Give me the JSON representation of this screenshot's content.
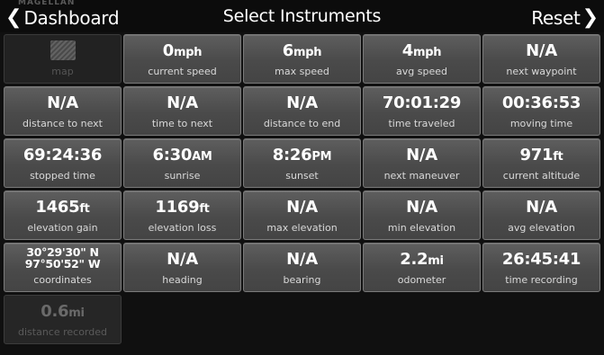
{
  "header": {
    "brand": "MAGELLAN",
    "back_label": "Dashboard",
    "title": "Select Instruments",
    "reset_label": "Reset"
  },
  "tiles": [
    {
      "value": "",
      "unit": "",
      "label": "map"
    },
    {
      "value": "0",
      "unit": "mph",
      "label": "current speed"
    },
    {
      "value": "6",
      "unit": "mph",
      "label": "max speed"
    },
    {
      "value": "4",
      "unit": "mph",
      "label": "avg speed"
    },
    {
      "value": "N/A",
      "unit": "",
      "label": "next waypoint"
    },
    {
      "value": "N/A",
      "unit": "",
      "label": "distance to next"
    },
    {
      "value": "N/A",
      "unit": "",
      "label": "time to next"
    },
    {
      "value": "N/A",
      "unit": "",
      "label": "distance to end"
    },
    {
      "value": "70:01:29",
      "unit": "",
      "label": "time traveled"
    },
    {
      "value": "00:36:53",
      "unit": "",
      "label": "moving time"
    },
    {
      "value": "69:24:36",
      "unit": "",
      "label": "stopped time"
    },
    {
      "value": "6:30",
      "unit": "AM",
      "label": "sunrise"
    },
    {
      "value": "8:26",
      "unit": "PM",
      "label": "sunset"
    },
    {
      "value": "N/A",
      "unit": "",
      "label": "next maneuver"
    },
    {
      "value": "971",
      "unit": "ft",
      "label": "current altitude"
    },
    {
      "value": "1465",
      "unit": "ft",
      "label": "elevation gain"
    },
    {
      "value": "1169",
      "unit": "ft",
      "label": "elevation loss"
    },
    {
      "value": "N/A",
      "unit": "",
      "label": "max elevation"
    },
    {
      "value": "N/A",
      "unit": "",
      "label": "min elevation"
    },
    {
      "value": "N/A",
      "unit": "",
      "label": "avg elevation"
    },
    {
      "value_line1": "30°29'30\" N",
      "value_line2": "97°50'52\" W",
      "label": "coordinates"
    },
    {
      "value": "N/A",
      "unit": "",
      "label": "heading"
    },
    {
      "value": "N/A",
      "unit": "",
      "label": "bearing"
    },
    {
      "value": "2.2",
      "unit": "mi",
      "label": "odometer"
    },
    {
      "value": "26:45:41",
      "unit": "",
      "label": "time recording"
    },
    {
      "value": "0.6",
      "unit": "mi",
      "label": "distance recorded"
    }
  ]
}
